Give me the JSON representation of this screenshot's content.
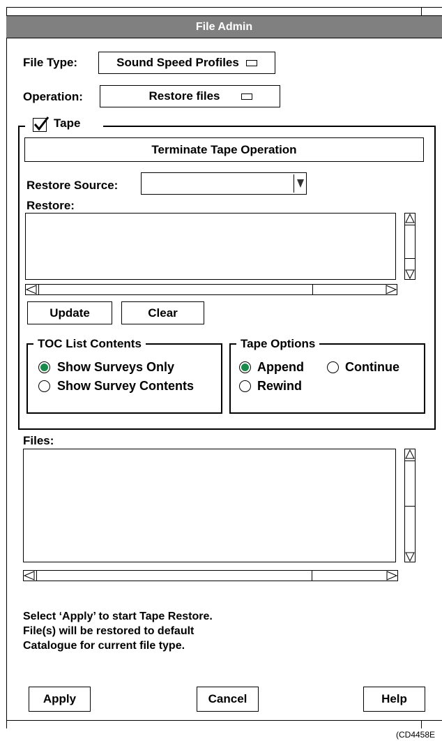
{
  "window": {
    "title": "File Admin"
  },
  "file_type": {
    "label": "File Type:",
    "value": "Sound Speed Profiles"
  },
  "operation": {
    "label": "Operation:",
    "value": "Restore files"
  },
  "tape": {
    "label": "Tape",
    "checked": true,
    "terminate_label": "Terminate Tape Operation",
    "restore_source_label": "Restore Source:",
    "restore_source_value": "",
    "restore_label": "Restore:",
    "update_label": "Update",
    "clear_label": "Clear",
    "toc": {
      "title": "TOC List Contents",
      "options": [
        "Show Surveys Only",
        "Show Survey Contents"
      ],
      "selected": "Show Surveys Only"
    },
    "tape_options": {
      "title": "Tape Options",
      "options": [
        "Append",
        "Continue",
        "Rewind"
      ],
      "selected": "Append"
    }
  },
  "files": {
    "label": "Files:"
  },
  "message": {
    "line1": "Select ‘Apply’ to start Tape Restore.",
    "line2": "File(s) will be restored to default",
    "line3": "Catalogue for current file type."
  },
  "buttons": {
    "apply": "Apply",
    "cancel": "Cancel",
    "help": "Help"
  },
  "figure_id": "(CD4458E"
}
